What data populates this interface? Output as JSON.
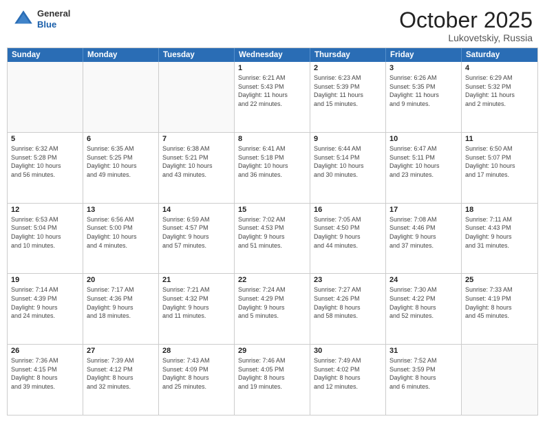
{
  "header": {
    "logo": {
      "general": "General",
      "blue": "Blue"
    },
    "title": "October 2025",
    "location": "Lukovetskiy, Russia"
  },
  "weekdays": [
    "Sunday",
    "Monday",
    "Tuesday",
    "Wednesday",
    "Thursday",
    "Friday",
    "Saturday"
  ],
  "weeks": [
    [
      {
        "day": "",
        "info": ""
      },
      {
        "day": "",
        "info": ""
      },
      {
        "day": "",
        "info": ""
      },
      {
        "day": "1",
        "info": "Sunrise: 6:21 AM\nSunset: 5:43 PM\nDaylight: 11 hours\nand 22 minutes."
      },
      {
        "day": "2",
        "info": "Sunrise: 6:23 AM\nSunset: 5:39 PM\nDaylight: 11 hours\nand 15 minutes."
      },
      {
        "day": "3",
        "info": "Sunrise: 6:26 AM\nSunset: 5:35 PM\nDaylight: 11 hours\nand 9 minutes."
      },
      {
        "day": "4",
        "info": "Sunrise: 6:29 AM\nSunset: 5:32 PM\nDaylight: 11 hours\nand 2 minutes."
      }
    ],
    [
      {
        "day": "5",
        "info": "Sunrise: 6:32 AM\nSunset: 5:28 PM\nDaylight: 10 hours\nand 56 minutes."
      },
      {
        "day": "6",
        "info": "Sunrise: 6:35 AM\nSunset: 5:25 PM\nDaylight: 10 hours\nand 49 minutes."
      },
      {
        "day": "7",
        "info": "Sunrise: 6:38 AM\nSunset: 5:21 PM\nDaylight: 10 hours\nand 43 minutes."
      },
      {
        "day": "8",
        "info": "Sunrise: 6:41 AM\nSunset: 5:18 PM\nDaylight: 10 hours\nand 36 minutes."
      },
      {
        "day": "9",
        "info": "Sunrise: 6:44 AM\nSunset: 5:14 PM\nDaylight: 10 hours\nand 30 minutes."
      },
      {
        "day": "10",
        "info": "Sunrise: 6:47 AM\nSunset: 5:11 PM\nDaylight: 10 hours\nand 23 minutes."
      },
      {
        "day": "11",
        "info": "Sunrise: 6:50 AM\nSunset: 5:07 PM\nDaylight: 10 hours\nand 17 minutes."
      }
    ],
    [
      {
        "day": "12",
        "info": "Sunrise: 6:53 AM\nSunset: 5:04 PM\nDaylight: 10 hours\nand 10 minutes."
      },
      {
        "day": "13",
        "info": "Sunrise: 6:56 AM\nSunset: 5:00 PM\nDaylight: 10 hours\nand 4 minutes."
      },
      {
        "day": "14",
        "info": "Sunrise: 6:59 AM\nSunset: 4:57 PM\nDaylight: 9 hours\nand 57 minutes."
      },
      {
        "day": "15",
        "info": "Sunrise: 7:02 AM\nSunset: 4:53 PM\nDaylight: 9 hours\nand 51 minutes."
      },
      {
        "day": "16",
        "info": "Sunrise: 7:05 AM\nSunset: 4:50 PM\nDaylight: 9 hours\nand 44 minutes."
      },
      {
        "day": "17",
        "info": "Sunrise: 7:08 AM\nSunset: 4:46 PM\nDaylight: 9 hours\nand 37 minutes."
      },
      {
        "day": "18",
        "info": "Sunrise: 7:11 AM\nSunset: 4:43 PM\nDaylight: 9 hours\nand 31 minutes."
      }
    ],
    [
      {
        "day": "19",
        "info": "Sunrise: 7:14 AM\nSunset: 4:39 PM\nDaylight: 9 hours\nand 24 minutes."
      },
      {
        "day": "20",
        "info": "Sunrise: 7:17 AM\nSunset: 4:36 PM\nDaylight: 9 hours\nand 18 minutes."
      },
      {
        "day": "21",
        "info": "Sunrise: 7:21 AM\nSunset: 4:32 PM\nDaylight: 9 hours\nand 11 minutes."
      },
      {
        "day": "22",
        "info": "Sunrise: 7:24 AM\nSunset: 4:29 PM\nDaylight: 9 hours\nand 5 minutes."
      },
      {
        "day": "23",
        "info": "Sunrise: 7:27 AM\nSunset: 4:26 PM\nDaylight: 8 hours\nand 58 minutes."
      },
      {
        "day": "24",
        "info": "Sunrise: 7:30 AM\nSunset: 4:22 PM\nDaylight: 8 hours\nand 52 minutes."
      },
      {
        "day": "25",
        "info": "Sunrise: 7:33 AM\nSunset: 4:19 PM\nDaylight: 8 hours\nand 45 minutes."
      }
    ],
    [
      {
        "day": "26",
        "info": "Sunrise: 7:36 AM\nSunset: 4:15 PM\nDaylight: 8 hours\nand 39 minutes."
      },
      {
        "day": "27",
        "info": "Sunrise: 7:39 AM\nSunset: 4:12 PM\nDaylight: 8 hours\nand 32 minutes."
      },
      {
        "day": "28",
        "info": "Sunrise: 7:43 AM\nSunset: 4:09 PM\nDaylight: 8 hours\nand 25 minutes."
      },
      {
        "day": "29",
        "info": "Sunrise: 7:46 AM\nSunset: 4:05 PM\nDaylight: 8 hours\nand 19 minutes."
      },
      {
        "day": "30",
        "info": "Sunrise: 7:49 AM\nSunset: 4:02 PM\nDaylight: 8 hours\nand 12 minutes."
      },
      {
        "day": "31",
        "info": "Sunrise: 7:52 AM\nSunset: 3:59 PM\nDaylight: 8 hours\nand 6 minutes."
      },
      {
        "day": "",
        "info": ""
      }
    ]
  ]
}
